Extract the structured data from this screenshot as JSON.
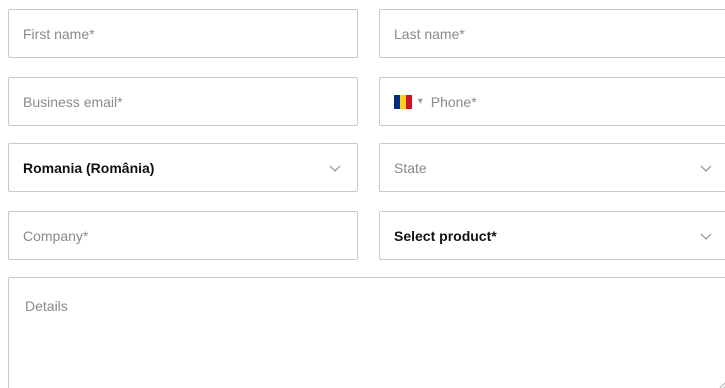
{
  "form": {
    "first_name": {
      "placeholder": "First name*"
    },
    "last_name": {
      "placeholder": "Last name*"
    },
    "business_email": {
      "placeholder": "Business email*"
    },
    "phone": {
      "placeholder": "Phone*",
      "country_flag": "romania-flag-icon",
      "flag_colors": [
        "#002B7F",
        "#FCD116",
        "#CE1126"
      ]
    },
    "country": {
      "value": "Romania (România)"
    },
    "state": {
      "value": "State"
    },
    "company": {
      "placeholder": "Company*"
    },
    "product": {
      "value": "Select product*"
    },
    "details": {
      "placeholder": "Details"
    }
  }
}
